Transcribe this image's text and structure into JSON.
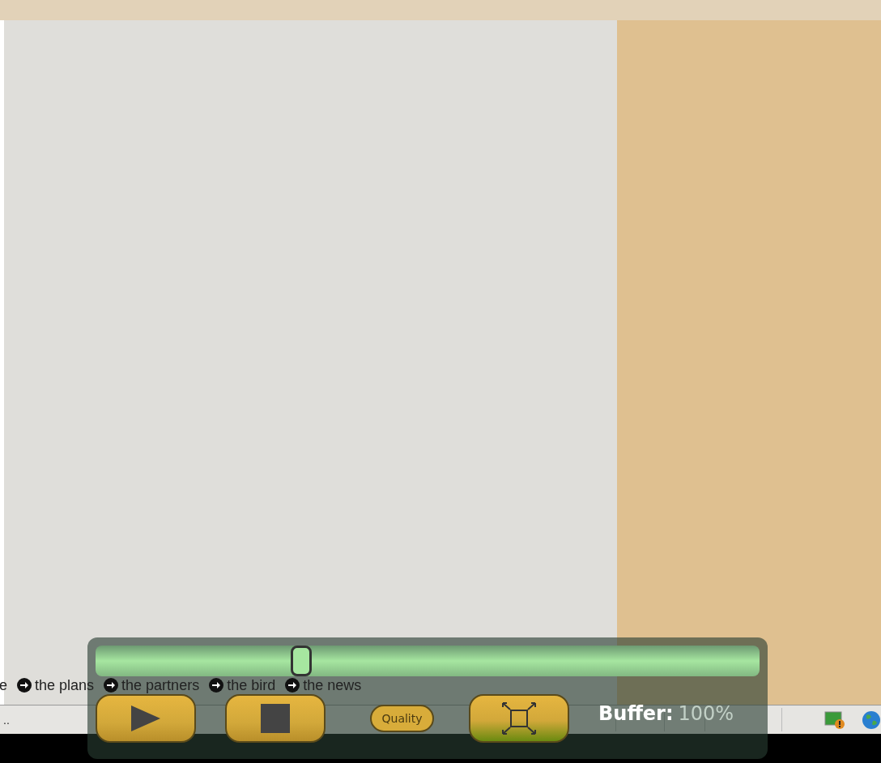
{
  "nav_links": [
    {
      "label": "e",
      "icon": false
    },
    {
      "label": "the plans",
      "icon": true
    },
    {
      "label": "the partners",
      "icon": true
    },
    {
      "label": "the bird",
      "icon": true
    },
    {
      "label": "the news",
      "icon": true
    }
  ],
  "status_bar": {
    "text": ".."
  },
  "player": {
    "seek": {
      "level": 0.31
    },
    "buttons": [
      {
        "kind": "play"
      },
      {
        "kind": "stop"
      },
      {
        "kind": "quality",
        "label": "Quality"
      },
      {
        "kind": "fullscreen"
      }
    ],
    "buffer_label": "Buffer:",
    "buffer_value": "100%"
  }
}
